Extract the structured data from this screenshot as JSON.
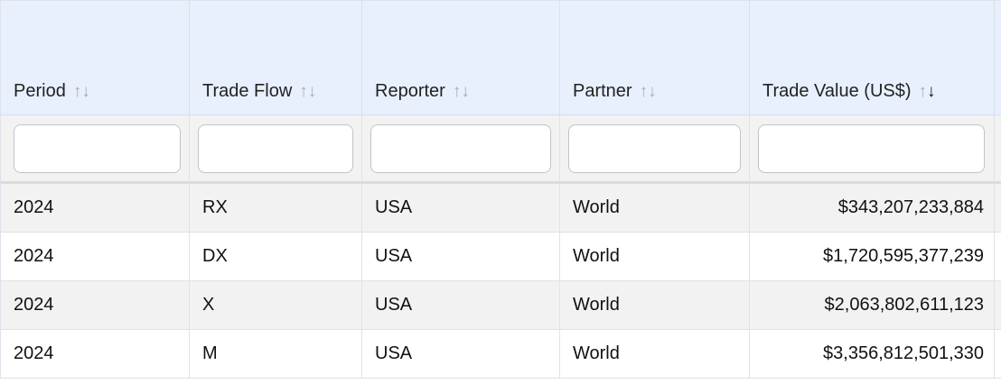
{
  "table": {
    "columns": [
      {
        "label": "Period",
        "sort_up": "↑",
        "sort_down": "↓"
      },
      {
        "label": "Trade Flow",
        "sort_up": "↑",
        "sort_down": "↓"
      },
      {
        "label": "Reporter",
        "sort_up": "↑",
        "sort_down": "↓"
      },
      {
        "label": "Partner",
        "sort_up": "↑",
        "sort_down": "↓"
      },
      {
        "label": "Trade Value (US$)",
        "sort_up": "↑",
        "sort_down": "↓",
        "sorted": "descending"
      }
    ],
    "filters": [
      "",
      "",
      "",
      "",
      ""
    ],
    "rows": [
      {
        "period": "2024",
        "trade_flow": "RX",
        "reporter": "USA",
        "partner": "World",
        "trade_value": "$343,207,233,884"
      },
      {
        "period": "2024",
        "trade_flow": "DX",
        "reporter": "USA",
        "partner": "World",
        "trade_value": "$1,720,595,377,239"
      },
      {
        "period": "2024",
        "trade_flow": "X",
        "reporter": "USA",
        "partner": "World",
        "trade_value": "$2,063,802,611,123"
      },
      {
        "period": "2024",
        "trade_flow": "M",
        "reporter": "USA",
        "partner": "World",
        "trade_value": "$3,356,812,501,330"
      }
    ]
  },
  "colors": {
    "header_bg": "#e8f0fd",
    "filter_row_bg": "#f2f2f2",
    "odd_row_bg": "#f2f2f2",
    "even_row_bg": "#ffffff",
    "sort_inactive": "#a8adb3",
    "sort_active": "#111111"
  }
}
